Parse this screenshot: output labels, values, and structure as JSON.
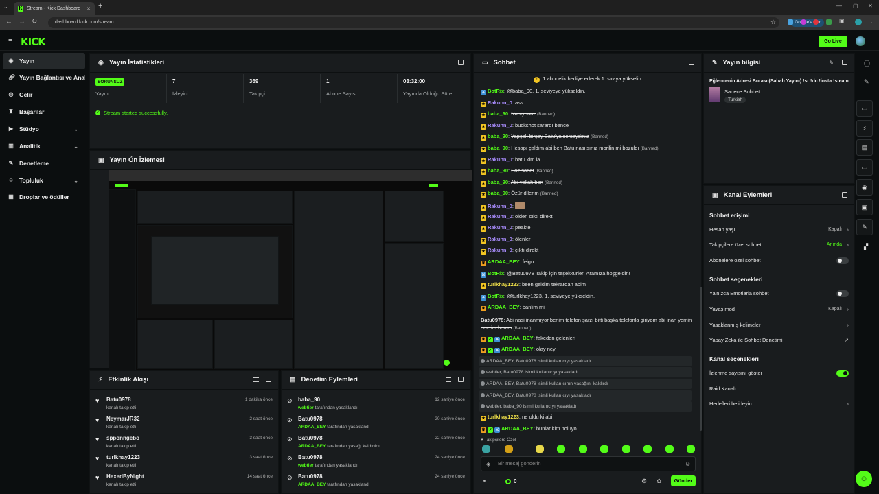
{
  "browser": {
    "tab_title": "Stream - Kick Dashboard",
    "url": "dashboard.kick.com/stream",
    "google_pill": "Google'a Sor"
  },
  "app": {
    "logo": "KICK",
    "go_live": "Go Live",
    "accent": "#53fc18"
  },
  "sidebar": {
    "items": [
      {
        "label": "Yayın",
        "icon": "broadcast-icon"
      },
      {
        "label": "Yayın Bağlantısı ve Anahtarı",
        "icon": "link-icon"
      },
      {
        "label": "Gelir",
        "icon": "dollar-icon"
      },
      {
        "label": "Başarılar",
        "icon": "trophy-icon"
      },
      {
        "label": "Stüdyo",
        "icon": "studio-icon"
      },
      {
        "label": "Analitik",
        "icon": "chart-icon"
      },
      {
        "label": "Denetleme",
        "icon": "wrench-icon"
      },
      {
        "label": "Topluluk",
        "icon": "people-icon"
      },
      {
        "label": "Droplar ve ödüller",
        "icon": "gift-icon"
      }
    ]
  },
  "stats": {
    "title": "Yayın İstatistikleri",
    "status_badge": "SORUNSUZ",
    "status_label": "Yayın",
    "viewers": "7",
    "viewers_label": "İzleyici",
    "followers": "369",
    "followers_label": "Takipçi",
    "subs": "1",
    "subs_label": "Abone Sayısı",
    "uptime": "03:32:00",
    "uptime_label": "Yayında Olduğu Süre",
    "message": "Stream started successfully."
  },
  "preview": {
    "title": "Yayın Ön İzlemesi"
  },
  "activity": {
    "title": "Etkinlik Akışı",
    "rows": [
      {
        "name": "Batu0978",
        "sub": "kanalı takip etti",
        "time": "1 dakika önce"
      },
      {
        "name": "NeymarJR32",
        "sub": "kanalı takip etti",
        "time": "2 saat önce"
      },
      {
        "name": "spponngebo",
        "sub": "kanalı takip etti",
        "time": "3 saat önce"
      },
      {
        "name": "turlkhay1223",
        "sub": "kanalı takip etti",
        "time": "3 saat önce"
      },
      {
        "name": "HexedByNight",
        "sub": "kanalı takip etti",
        "time": "14 saat önce"
      }
    ]
  },
  "moderation": {
    "title": "Denetim Eylemleri",
    "rows": [
      {
        "name": "baba_90",
        "actor": "webtier",
        "sub": "tarafından yasaklandı",
        "time": "12 saniye önce"
      },
      {
        "name": "Batu0978",
        "actor": "ARDAA_BEY",
        "sub": "tarafından yasaklandı",
        "time": "20 saniye önce"
      },
      {
        "name": "Batu0978",
        "actor": "ARDAA_BEY",
        "sub": "tarafından yasağı kaldırıldı",
        "time": "22 saniye önce"
      },
      {
        "name": "Batu0978",
        "actor": "webtier",
        "sub": "tarafından yasaklandı",
        "time": "24 saniye önce"
      },
      {
        "name": "Batu0978",
        "actor": "ARDAA_BEY",
        "sub": "tarafından yasaklandı",
        "time": "24 saniye önce"
      }
    ]
  },
  "chat": {
    "title": "Sohbet",
    "pinned": "1 abonelik hediye ederek 1. sıraya yükselin",
    "lines": [
      {
        "user": "BotRix",
        "color": "#53fc18",
        "text": "@baba_90, 1. seviyeye yükseldin.",
        "struck": false,
        "banned": ""
      },
      {
        "user": "Rakunn_0",
        "color": "#a78bfa",
        "text": "ass",
        "struck": false,
        "banned": ""
      },
      {
        "user": "baba_90",
        "color": "#53fc18",
        "text": "Napıyonuz",
        "struck": true,
        "banned": "(Banned)"
      },
      {
        "user": "Rakunn_0",
        "color": "#a78bfa",
        "text": "buckshot sarardı bence",
        "struck": false,
        "banned": ""
      },
      {
        "user": "baba_90",
        "color": "#53fc18",
        "text": "Yapçak birşey Batu'ya sorsaydınız",
        "struck": true,
        "banned": "(Banned)"
      },
      {
        "user": "baba_90",
        "color": "#53fc18",
        "text": "Hesapı çaldım abi ben Batu nasılsınız morilin mi bozuldı",
        "struck": true,
        "banned": "(Banned)"
      },
      {
        "user": "Rakunn_0",
        "color": "#a78bfa",
        "text": "batu kim la",
        "struck": false,
        "banned": ""
      },
      {
        "user": "baba_90",
        "color": "#53fc18",
        "text": "Söz sanat",
        "struck": true,
        "banned": "(Banned)"
      },
      {
        "user": "baba_90",
        "color": "#53fc18",
        "text": "Abi vallah ben",
        "struck": true,
        "banned": "(Banned)"
      },
      {
        "user": "baba_90",
        "color": "#53fc18",
        "text": "Özür dilerim",
        "struck": true,
        "banned": "(Banned)"
      },
      {
        "user": "Rakunn_0",
        "color": "#a78bfa",
        "text": "",
        "struck": false,
        "banned": ""
      },
      {
        "user": "Rakunn_0",
        "color": "#a78bfa",
        "text": "ölden cıktı direkt",
        "struck": false,
        "banned": ""
      },
      {
        "user": "Rakunn_0",
        "color": "#a78bfa",
        "text": "peakte",
        "struck": false,
        "banned": ""
      },
      {
        "user": "Rakunn_0",
        "color": "#a78bfa",
        "text": "ölenler",
        "struck": false,
        "banned": ""
      },
      {
        "user": "Rakunn_0",
        "color": "#a78bfa",
        "text": "çıktı direkt",
        "struck": false,
        "banned": ""
      },
      {
        "user": "ARDAA_BEY",
        "color": "#53fc18",
        "text": "feign",
        "struck": false,
        "banned": ""
      },
      {
        "user": "BotRix",
        "color": "#53fc18",
        "text": "@Batu0978 Takip için teşekkürler! Aramıza hoşgeldin!",
        "struck": false,
        "banned": ""
      },
      {
        "user": "turlkhay1223",
        "color": "#f3e34a",
        "text": "been geldim tekrardan abim",
        "struck": false,
        "banned": ""
      },
      {
        "user": "BotRix",
        "color": "#53fc18",
        "text": "@turlkhay1223, 1. seviyeye yükseldin.",
        "struck": false,
        "banned": ""
      },
      {
        "user": "ARDAA_BEY",
        "color": "#53fc18",
        "text": "banlim mi",
        "struck": false,
        "banned": ""
      }
    ],
    "long_line_user": "Batu0978",
    "long_line_text": "Abi nasi inanmıyor benim telefon şarzı bitti başka telefonla giriyom abi inan yemin ederim benim",
    "long_line_banned": "(Banned)",
    "after": [
      {
        "user": "ARDAA_BEY",
        "text": "fakeden gelenleri"
      },
      {
        "user": "ARDAA_BEY",
        "text": "olay ney"
      }
    ],
    "modlogs": [
      "ARDAA_BEY, Batu0978 isimli kullanıcıyı yasakladı",
      "webtier, Batu0978 isimli kullanıcıyı yasakladı",
      "ARDAA_BEY, Batu0978 isimli kullanıcının yasağını kaldırdı",
      "ARDAA_BEY, Batu0978 isimli kullanıcıyı yasakladı",
      "webtier, baba_90 isimli kullanıcıyı yasakladı"
    ],
    "tail": [
      {
        "user": "turlkhay1223",
        "color": "#f3e34a",
        "text": "ne oldu ki abi"
      },
      {
        "user": "ARDAA_BEY",
        "color": "#53fc18",
        "text": "bunlar kim noluyo"
      }
    ],
    "followers_only": "Takipçilere Özel",
    "input_placeholder": "Bir mesaj gönderin",
    "points": "0",
    "send": "Gönder"
  },
  "stream_info": {
    "title": "Yayın bilgisi",
    "stream_title": "Eğlencenin Adresi Burası (Sabah Yayını) !sr !dc !insta !steam",
    "category": "Sadece Sohbet",
    "language": "Turkish"
  },
  "channel_actions": {
    "title": "Kanal Eylemleri",
    "chat_access": "Sohbet erişimi",
    "account_age": "Hesap yaşı",
    "account_age_val": "Kapalı",
    "followers_chat": "Takipçilere özel sohbet",
    "followers_chat_val": "Anında",
    "subs_chat": "Abonelere özel sohbet",
    "chat_options": "Sohbet seçenekleri",
    "emotes_only": "Yalnızca Emotlarla sohbet",
    "slow_mode": "Yavaş mod",
    "slow_mode_val": "Kapalı",
    "banned_words": "Yasaklanmış kelimeler",
    "ai_mod": "Yapay Zeka ile Sohbet Denetimi",
    "channel_options": "Kanal seçenekleri",
    "show_viewers": "İzlenme sayısını göster",
    "raid": "Raid Kanalı",
    "goals": "Hedefleri belirleyin"
  }
}
